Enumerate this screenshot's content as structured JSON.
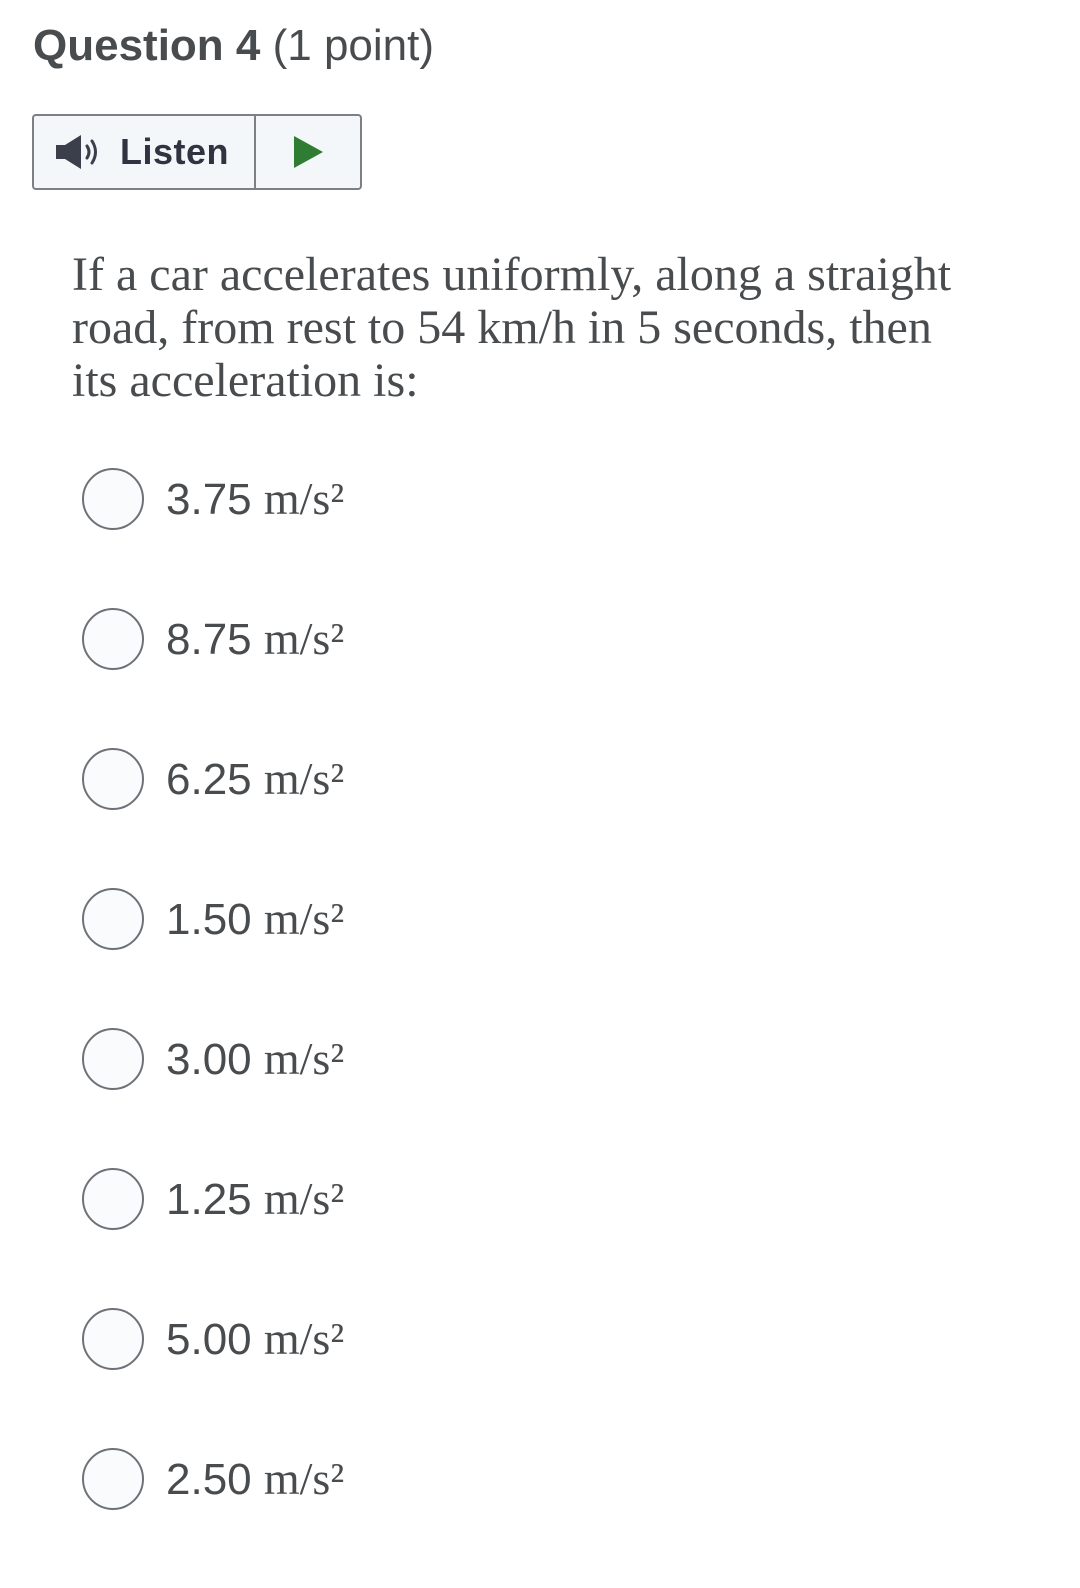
{
  "question": {
    "label": "Question 4",
    "points": "(1 point)"
  },
  "listen": {
    "label": "Listen",
    "speaker_icon": "speaker-icon",
    "play_icon": "play-icon",
    "play_color": "#2e7d32"
  },
  "prompt": "If a car accelerates uniformly, along a straight road, from rest to 54 km/h in 5 seconds, then its acceleration is:",
  "options": [
    {
      "value": "3.75",
      "unit": "m/s²"
    },
    {
      "value": "8.75",
      "unit": "m/s²"
    },
    {
      "value": "6.25",
      "unit": "m/s²"
    },
    {
      "value": "1.50",
      "unit": "m/s²"
    },
    {
      "value": "3.00",
      "unit": "m/s²"
    },
    {
      "value": "1.25",
      "unit": "m/s²"
    },
    {
      "value": "5.00",
      "unit": "m/s²"
    },
    {
      "value": "2.50",
      "unit": "m/s²"
    }
  ]
}
